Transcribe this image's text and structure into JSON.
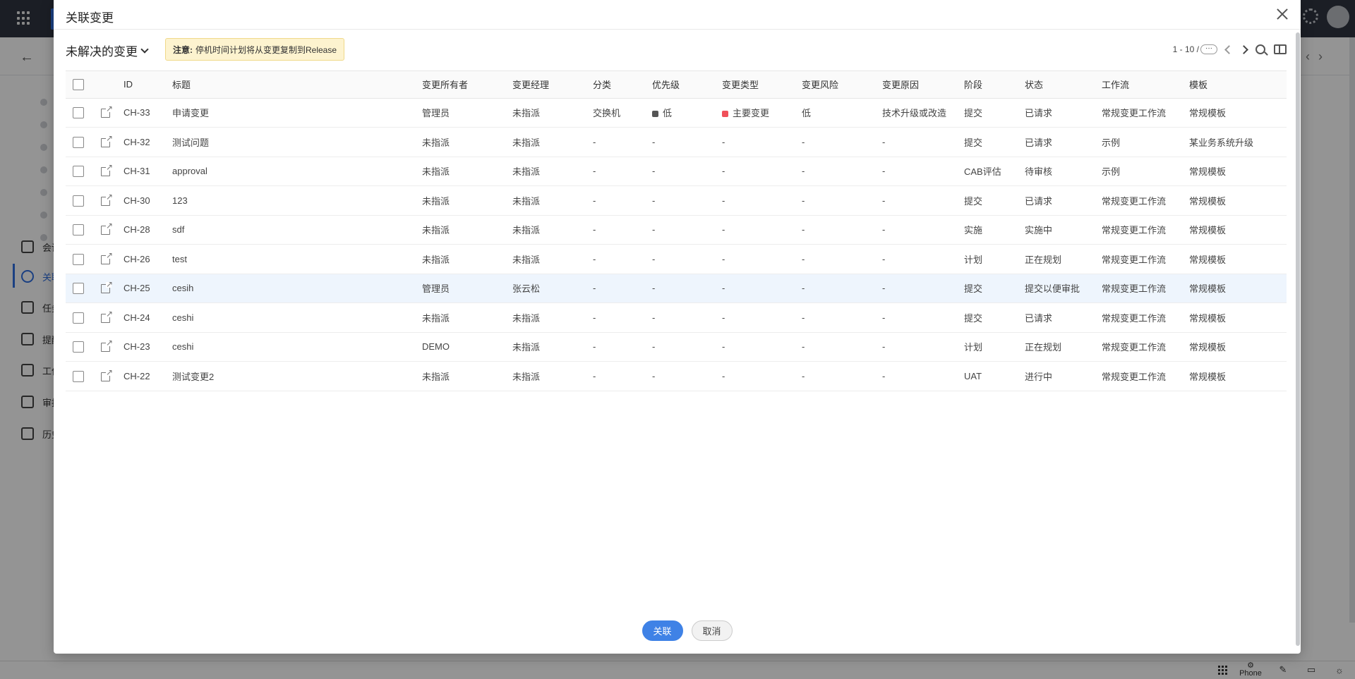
{
  "background": {
    "side_items": [
      {
        "label": "会议",
        "icon": "chat-icon"
      },
      {
        "label": "关联",
        "icon": "relation-icon"
      },
      {
        "label": "任务",
        "icon": "clipboard-icon"
      },
      {
        "label": "提醒",
        "icon": "alarm-icon"
      },
      {
        "label": "工作",
        "icon": "gauge-icon"
      },
      {
        "label": "审批",
        "icon": "check-circle-icon"
      },
      {
        "label": "历史",
        "icon": "history-icon"
      }
    ],
    "footer": {
      "phone_label": "Phone"
    }
  },
  "modal": {
    "title": "关联变更",
    "view": "未解决的变更",
    "notice_prefix": "注意:",
    "notice_text": "停机时间计划将从变更复制到Release",
    "pager": "1 - 10 /",
    "pager_more": "···",
    "columns": [
      "ID",
      "标题",
      "变更所有者",
      "变更经理",
      "分类",
      "优先级",
      "变更类型",
      "变更风险",
      "变更原因",
      "阶段",
      "状态",
      "工作流",
      "模板"
    ],
    "rows": [
      {
        "id": "CH-33",
        "title": "申请变更",
        "owner": "管理员",
        "manager": "未指派",
        "category": "交换机",
        "priority": "低",
        "priority_color": "#555555",
        "type": "主要变更",
        "type_color": "#f0505a",
        "risk": "低",
        "reason": "技术升级或改造",
        "stage": "提交",
        "status": "已请求",
        "workflow": "常规变更工作流",
        "template": "常规模板"
      },
      {
        "id": "CH-32",
        "title": "测试问题",
        "owner": "未指派",
        "manager": "未指派",
        "category": "-",
        "priority": "-",
        "priority_color": "",
        "type": "-",
        "type_color": "",
        "risk": "-",
        "reason": "-",
        "stage": "提交",
        "status": "已请求",
        "workflow": "示例",
        "template": "某业务系统升级"
      },
      {
        "id": "CH-31",
        "title": "approval",
        "owner": "未指派",
        "manager": "未指派",
        "category": "-",
        "priority": "-",
        "priority_color": "",
        "type": "-",
        "type_color": "",
        "risk": "-",
        "reason": "-",
        "stage": "CAB评估",
        "status": "待审核",
        "workflow": "示例",
        "template": "常规模板"
      },
      {
        "id": "CH-30",
        "title": "123",
        "owner": "未指派",
        "manager": "未指派",
        "category": "-",
        "priority": "-",
        "priority_color": "",
        "type": "-",
        "type_color": "",
        "risk": "-",
        "reason": "-",
        "stage": "提交",
        "status": "已请求",
        "workflow": "常规变更工作流",
        "template": "常规模板"
      },
      {
        "id": "CH-28",
        "title": "sdf",
        "owner": "未指派",
        "manager": "未指派",
        "category": "-",
        "priority": "-",
        "priority_color": "",
        "type": "-",
        "type_color": "",
        "risk": "-",
        "reason": "-",
        "stage": "实施",
        "status": "实施中",
        "workflow": "常规变更工作流",
        "template": "常规模板"
      },
      {
        "id": "CH-26",
        "title": "test",
        "owner": "未指派",
        "manager": "未指派",
        "category": "-",
        "priority": "-",
        "priority_color": "",
        "type": "-",
        "type_color": "",
        "risk": "-",
        "reason": "-",
        "stage": "计划",
        "status": "正在规划",
        "workflow": "常规变更工作流",
        "template": "常规模板"
      },
      {
        "id": "CH-25",
        "title": "cesih",
        "owner": "管理员",
        "manager": "张云松",
        "category": "-",
        "priority": "-",
        "priority_color": "",
        "type": "-",
        "type_color": "",
        "risk": "-",
        "reason": "-",
        "stage": "提交",
        "status": "提交以便审批",
        "workflow": "常规变更工作流",
        "template": "常规模板",
        "highlight": true
      },
      {
        "id": "CH-24",
        "title": "ceshi",
        "owner": "未指派",
        "manager": "未指派",
        "category": "-",
        "priority": "-",
        "priority_color": "",
        "type": "-",
        "type_color": "",
        "risk": "-",
        "reason": "-",
        "stage": "提交",
        "status": "已请求",
        "workflow": "常规变更工作流",
        "template": "常规模板"
      },
      {
        "id": "CH-23",
        "title": "ceshi",
        "owner": "DEMO",
        "manager": "未指派",
        "category": "-",
        "priority": "-",
        "priority_color": "",
        "type": "-",
        "type_color": "",
        "risk": "-",
        "reason": "-",
        "stage": "计划",
        "status": "正在规划",
        "workflow": "常规变更工作流",
        "template": "常规模板"
      },
      {
        "id": "CH-22",
        "title": "测试变更2",
        "owner": "未指派",
        "manager": "未指派",
        "category": "-",
        "priority": "-",
        "priority_color": "",
        "type": "-",
        "type_color": "",
        "risk": "-",
        "reason": "-",
        "stage": "UAT",
        "status": "进行中",
        "workflow": "常规变更工作流",
        "template": "常规模板"
      }
    ],
    "buttons": {
      "confirm": "关联",
      "cancel": "取消"
    }
  }
}
